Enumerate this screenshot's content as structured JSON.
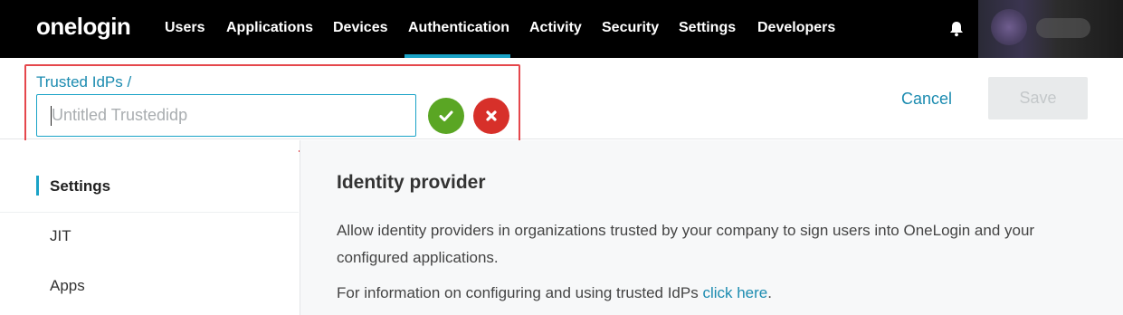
{
  "app": {
    "logo_text": "onelogin"
  },
  "nav": {
    "items": [
      "Users",
      "Applications",
      "Devices",
      "Authentication",
      "Activity",
      "Security",
      "Settings",
      "Developers"
    ],
    "active": "Authentication",
    "accent": "#1aa3c7"
  },
  "header": {
    "breadcrumb": "Trusted IdPs /",
    "title_placeholder": "Untitled Trustedidp",
    "title_value": "",
    "cancel_label": "Cancel",
    "save_label": "Save",
    "confirm_icon": "check-icon",
    "discard_icon": "close-icon"
  },
  "sidebar": {
    "items": [
      {
        "label": "Settings",
        "active": true
      },
      {
        "label": "JIT",
        "active": false
      },
      {
        "label": "Apps",
        "active": false
      }
    ]
  },
  "main": {
    "heading": "Identity provider",
    "description": "Allow identity providers in organizations trusted by your company to sign users into OneLogin and your configured applications.",
    "info_prefix": "For information on configuring and using trusted IdPs ",
    "info_link": "click here",
    "info_suffix": "."
  },
  "colors": {
    "confirm": "#5aa624",
    "discard": "#d7302a",
    "link": "#1b8bb0",
    "highlight": "#e5474c"
  }
}
